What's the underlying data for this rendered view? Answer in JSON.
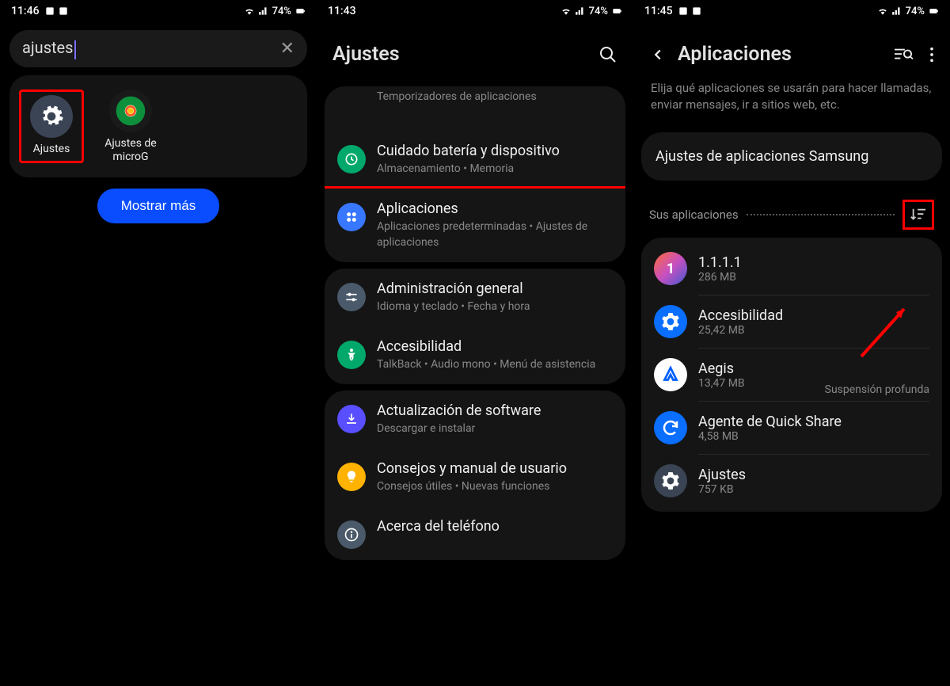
{
  "status": {
    "time1": "11:46",
    "time2": "11:43",
    "time3": "11:45",
    "battery": "74%"
  },
  "screen1": {
    "search_value": "ajustes",
    "app1_label": "Ajustes",
    "app2_label": "Ajustes de microG",
    "show_more": "Mostrar más"
  },
  "screen2": {
    "title": "Ajustes",
    "partial_sub": "Temporizadores de aplicaciones",
    "items": [
      {
        "title": "Cuidado batería y dispositivo",
        "sub": "Almacenamiento  •  Memoria"
      },
      {
        "title": "Aplicaciones",
        "sub": "Aplicaciones predeterminadas  •  Ajustes de aplicaciones"
      },
      {
        "title": "Administración general",
        "sub": "Idioma y teclado  •  Fecha y hora"
      },
      {
        "title": "Accesibilidad",
        "sub": "TalkBack  •  Audio mono  •  Menú de asistencia"
      },
      {
        "title": "Actualización de software",
        "sub": "Descargar e instalar"
      },
      {
        "title": "Consejos y manual de usuario",
        "sub": "Consejos útiles  •  Nuevas funciones"
      },
      {
        "title": "Acerca del teléfono",
        "sub": ""
      }
    ]
  },
  "screen3": {
    "title": "Aplicaciones",
    "desc": "Elija qué aplicaciones se usarán para hacer llamadas, enviar mensajes, ir a sitios web, etc.",
    "samsung_settings": "Ajustes de aplicaciones Samsung",
    "your_apps": "Sus aplicaciones",
    "apps": [
      {
        "name": "1.1.1.1",
        "size": "286 MB",
        "badge": ""
      },
      {
        "name": "Accesibilidad",
        "size": "25,42 MB",
        "badge": ""
      },
      {
        "name": "Aegis",
        "size": "13,47 MB",
        "badge": "Suspensión profunda"
      },
      {
        "name": "Agente de Quick Share",
        "size": "4,58 MB",
        "badge": ""
      },
      {
        "name": "Ajustes",
        "size": "757 KB",
        "badge": ""
      }
    ]
  }
}
